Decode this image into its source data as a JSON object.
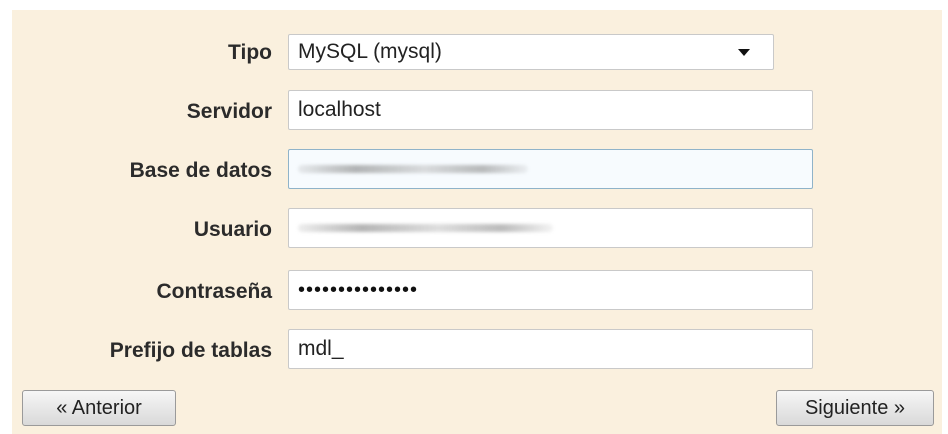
{
  "form": {
    "tipo": {
      "label": "Tipo",
      "value": "MySQL (mysql)"
    },
    "servidor": {
      "label": "Servidor",
      "value": "localhost"
    },
    "base_de_datos": {
      "label": "Base de datos",
      "value": ""
    },
    "usuario": {
      "label": "Usuario",
      "value": ""
    },
    "contrasena": {
      "label": "Contraseña",
      "value": "•••••••••••••••"
    },
    "prefijo": {
      "label": "Prefijo de tablas",
      "value": "mdl_"
    }
  },
  "buttons": {
    "previous": "« Anterior",
    "next": "Siguiente »"
  },
  "colors": {
    "panel_background": "#faf0de",
    "focused_border": "#8fb3c9"
  },
  "icons": {
    "dropdown": "chevron-down-icon"
  }
}
